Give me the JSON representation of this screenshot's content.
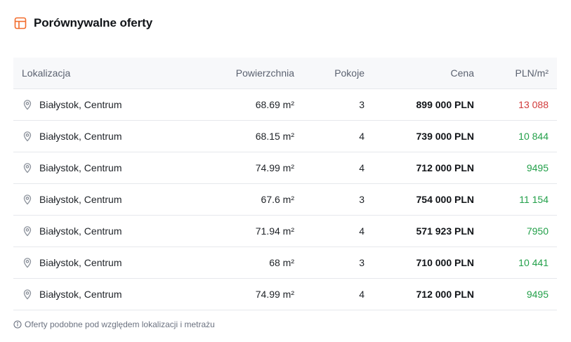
{
  "header": {
    "title": "Porównywalne oferty",
    "icon": "table-icon",
    "accent_color": "#f26b2a"
  },
  "table": {
    "columns": [
      "Lokalizacja",
      "Powierzchnia",
      "Pokoje",
      "Cena",
      "PLN/m²"
    ],
    "rows": [
      {
        "location": "Białystok, Centrum",
        "area": "68.69 m²",
        "rooms": "3",
        "price": "899 000 PLN",
        "ppm": "13 088",
        "ppm_color": "#d13b3b"
      },
      {
        "location": "Białystok, Centrum",
        "area": "68.15 m²",
        "rooms": "4",
        "price": "739 000 PLN",
        "ppm": "10 844",
        "ppm_color": "#23a04a"
      },
      {
        "location": "Białystok, Centrum",
        "area": "74.99 m²",
        "rooms": "4",
        "price": "712 000 PLN",
        "ppm": "9495",
        "ppm_color": "#23a04a"
      },
      {
        "location": "Białystok, Centrum",
        "area": "67.6 m²",
        "rooms": "3",
        "price": "754 000 PLN",
        "ppm": "11 154",
        "ppm_color": "#23a04a"
      },
      {
        "location": "Białystok, Centrum",
        "area": "71.94 m²",
        "rooms": "4",
        "price": "571 923 PLN",
        "ppm": "7950",
        "ppm_color": "#23a04a"
      },
      {
        "location": "Białystok, Centrum",
        "area": "68 m²",
        "rooms": "3",
        "price": "710 000 PLN",
        "ppm": "10 441",
        "ppm_color": "#23a04a"
      },
      {
        "location": "Białystok, Centrum",
        "area": "74.99 m²",
        "rooms": "4",
        "price": "712 000 PLN",
        "ppm": "9495",
        "ppm_color": "#23a04a"
      }
    ],
    "row_icon": "map-pin-icon"
  },
  "footnote": {
    "text": "Oferty podobne pod względem lokalizacji i metrażu",
    "icon": "info-icon"
  }
}
